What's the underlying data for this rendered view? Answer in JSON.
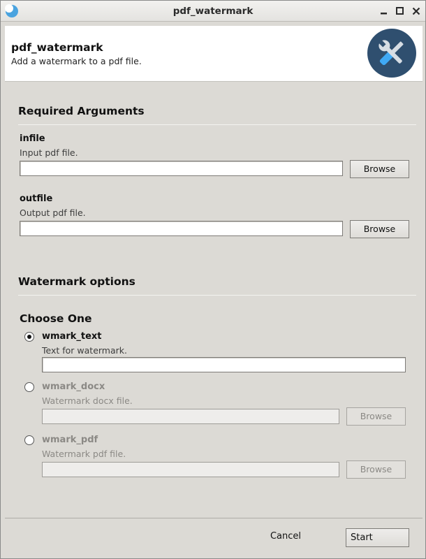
{
  "window": {
    "title": "pdf_watermark"
  },
  "header": {
    "program_name": "pdf_watermark",
    "program_description": "Add a watermark to a pdf file.",
    "logo_icon": "tools-icon"
  },
  "required_section": {
    "title": "Required Arguments",
    "fields": [
      {
        "name": "infile",
        "help": "Input pdf file.",
        "value": "",
        "button": "Browse"
      },
      {
        "name": "outfile",
        "help": "Output pdf file.",
        "value": "",
        "button": "Browse"
      }
    ]
  },
  "watermark_section": {
    "title": "Watermark options",
    "group_title": "Choose One",
    "options": [
      {
        "name": "wmark_text",
        "help": "Text for watermark.",
        "value": "",
        "selected": true,
        "enabled": true
      },
      {
        "name": "wmark_docx",
        "help": "Watermark docx file.",
        "value": "",
        "button": "Browse",
        "selected": false,
        "enabled": false
      },
      {
        "name": "wmark_pdf",
        "help": "Watermark pdf file.",
        "value": "",
        "button": "Browse",
        "selected": false,
        "enabled": false
      }
    ]
  },
  "footer": {
    "cancel_label": "Cancel",
    "start_label": "Start"
  },
  "colors": {
    "window_background": "#dcdad5",
    "header_background": "#ffffff",
    "logo_background": "#2f4f6f",
    "app_icon_blue": "#4aa3df",
    "disabled_text": "#8b8985"
  }
}
